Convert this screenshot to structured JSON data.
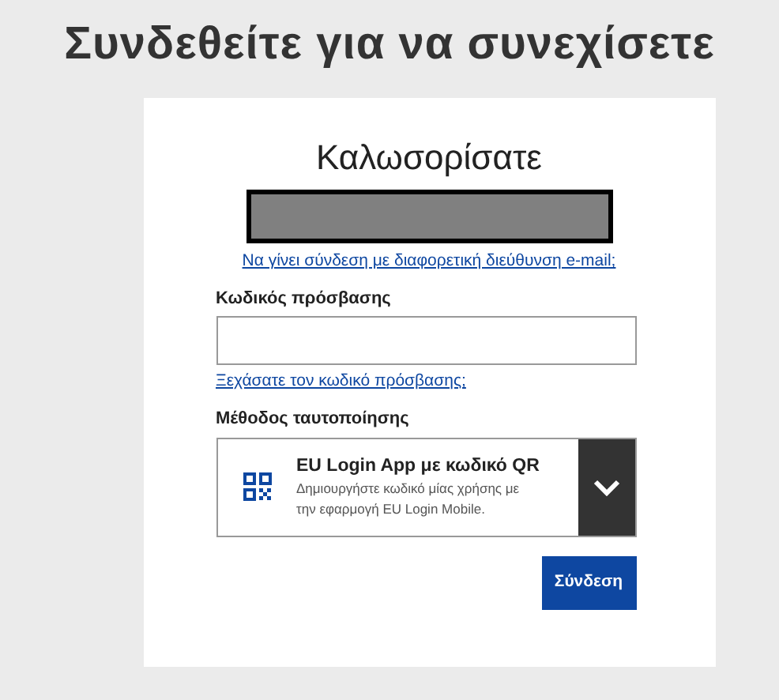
{
  "page_title": "Συνδεθείτε για να συνεχίσετε",
  "card": {
    "welcome": "Καλωσορίσατε",
    "other_email_link": "Να γίνει σύνδεση με διαφορετική διεύθυνση e-mail;",
    "password_label": "Κωδικός πρόσβασης",
    "forgot_link": "Ξεχάσατε τον κωδικό πρόσβασης;",
    "method_label": "Μέθοδος ταυτοποίησης",
    "method": {
      "title": "EU Login App με κωδικό QR",
      "description": "Δημιουργήστε κωδικό μίας χρήσης με την εφαρμογή EU Login Mobile."
    },
    "submit": "Σύνδεση"
  }
}
